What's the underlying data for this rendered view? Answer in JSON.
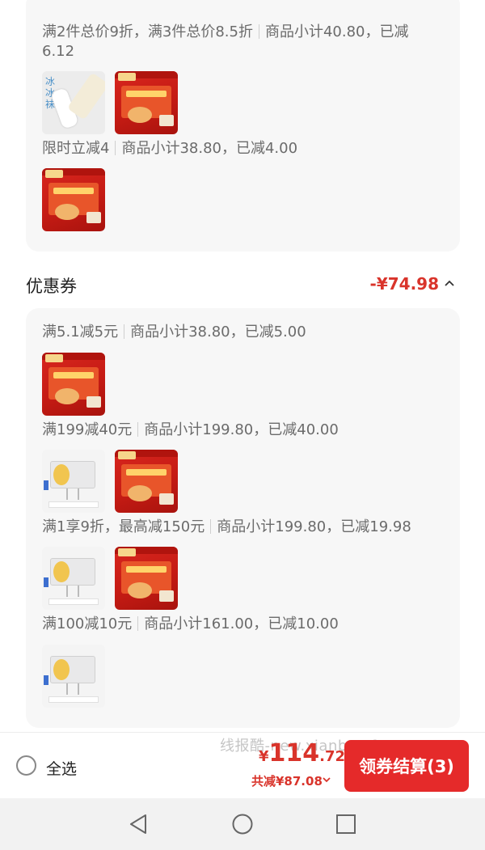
{
  "discount_card": {
    "promos": [
      {
        "rule": "满2件总价9折，满3件总价8.5折",
        "summary_line1": "商品小计40.80，已减",
        "summary_line2": "6.12"
      },
      {
        "rule": "限时立减4",
        "summary": "商品小计38.80，已减4.00"
      }
    ]
  },
  "coupon_section": {
    "title": "优惠券",
    "amount": "-¥74.98",
    "toggle_icon": "chevron-up-icon",
    "coupons": [
      {
        "rule": "满5.1减5元",
        "summary": "商品小计38.80，已减5.00"
      },
      {
        "rule": "满199减40元",
        "summary": "商品小计199.80，已减40.00"
      },
      {
        "rule": "满1享9折，最高减150元",
        "summary": "商品小计199.80，已减19.98"
      },
      {
        "rule": "满100减10元",
        "summary": "商品小计161.00，已减10.00"
      }
    ]
  },
  "thumbnails": {
    "socks_label": "冰\n冰\n袜"
  },
  "bottom_bar": {
    "select_all": "全选",
    "watermark": "线报酷-new.xianbao.fun",
    "price_currency": "¥",
    "price_integer": "114",
    "price_decimal": ".72",
    "total_saved": "共减¥87.08",
    "checkout_label": "领券结算(3)"
  },
  "navigation": {
    "back_icon": "back-triangle-icon",
    "home_icon": "home-circle-icon",
    "recent_icon": "recent-apps-square-icon"
  },
  "colors": {
    "accent": "#d9342b",
    "checkout_bg": "#e52a2a",
    "card_bg": "#f7f7f7"
  }
}
